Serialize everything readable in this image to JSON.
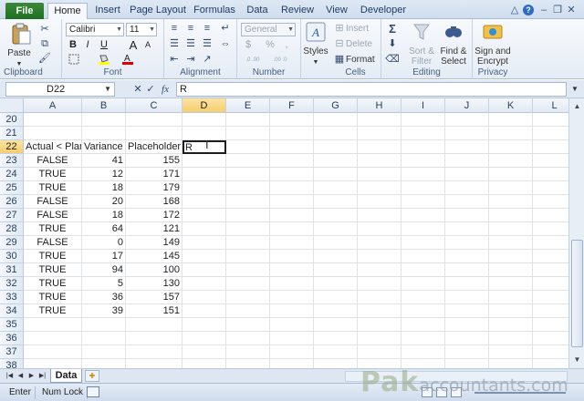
{
  "ribbon_tabs": [
    "File",
    "Home",
    "Insert",
    "Page Layout",
    "Formulas",
    "Data",
    "Review",
    "View",
    "Developer"
  ],
  "window_controls": {
    "minimize": "–",
    "restore": "❐",
    "close": "✕",
    "caret": "△",
    "help": "?"
  },
  "clipboard": {
    "paste_label": "Paste",
    "group_label": "Clipboard"
  },
  "font": {
    "name": "Calibri",
    "size": "11",
    "bold": "B",
    "italic": "I",
    "underline": "U",
    "grow": "A",
    "shrink": "A",
    "fill_color": "#ffff00",
    "font_color": "#e00000",
    "group_label": "Font"
  },
  "alignment": {
    "group_label": "Alignment"
  },
  "number": {
    "format": "General",
    "currency": "$",
    "percent": "%",
    "comma": ",",
    "increase_decimal": ".0 .00",
    "decrease_decimal": ".00 .0",
    "group_label": "Number"
  },
  "styles": {
    "label": "Styles"
  },
  "cells": {
    "insert_label": "Insert",
    "delete_label": "Delete",
    "format_label": "Format",
    "group_label": "Cells"
  },
  "editing": {
    "sigma": "Σ",
    "sort_filter_line1": "Sort &",
    "sort_filter_line2": "Filter",
    "find_select_line1": "Find &",
    "find_select_line2": "Select",
    "group_label": "Editing"
  },
  "privacy": {
    "sign_line1": "Sign and",
    "sign_line2": "Encrypt",
    "group_label": "Privacy"
  },
  "formula_bar": {
    "name_box": "D22",
    "cancel": "✕",
    "enter": "✓",
    "fx": "fx",
    "content": "R"
  },
  "columns": [
    "A",
    "B",
    "C",
    "D",
    "E",
    "F",
    "G",
    "H",
    "I",
    "J",
    "K",
    "L"
  ],
  "selected_column": "D",
  "selected_row": "22",
  "rows": [
    {
      "num": "20",
      "a": "",
      "b": "",
      "c": "",
      "d": ""
    },
    {
      "num": "21",
      "a": "",
      "b": "",
      "c": "",
      "d": ""
    },
    {
      "num": "22",
      "a": "Actual < Plan",
      "b": "Variance",
      "c": "Placeholder",
      "d": "R"
    },
    {
      "num": "23",
      "a": "FALSE",
      "b": "41",
      "c": "155",
      "d": ""
    },
    {
      "num": "24",
      "a": "TRUE",
      "b": "12",
      "c": "171",
      "d": ""
    },
    {
      "num": "25",
      "a": "TRUE",
      "b": "18",
      "c": "179",
      "d": ""
    },
    {
      "num": "26",
      "a": "FALSE",
      "b": "20",
      "c": "168",
      "d": ""
    },
    {
      "num": "27",
      "a": "FALSE",
      "b": "18",
      "c": "172",
      "d": ""
    },
    {
      "num": "28",
      "a": "TRUE",
      "b": "64",
      "c": "121",
      "d": ""
    },
    {
      "num": "29",
      "a": "FALSE",
      "b": "0",
      "c": "149",
      "d": ""
    },
    {
      "num": "30",
      "a": "TRUE",
      "b": "17",
      "c": "145",
      "d": ""
    },
    {
      "num": "31",
      "a": "TRUE",
      "b": "94",
      "c": "100",
      "d": ""
    },
    {
      "num": "32",
      "a": "TRUE",
      "b": "5",
      "c": "130",
      "d": ""
    },
    {
      "num": "33",
      "a": "TRUE",
      "b": "36",
      "c": "157",
      "d": ""
    },
    {
      "num": "34",
      "a": "TRUE",
      "b": "39",
      "c": "151",
      "d": ""
    },
    {
      "num": "35",
      "a": "",
      "b": "",
      "c": "",
      "d": ""
    },
    {
      "num": "36",
      "a": "",
      "b": "",
      "c": "",
      "d": ""
    },
    {
      "num": "37",
      "a": "",
      "b": "",
      "c": "",
      "d": ""
    },
    {
      "num": "38",
      "a": "",
      "b": "",
      "c": "",
      "d": ""
    }
  ],
  "sheet_tab": "Data",
  "status": {
    "mode": "Enter",
    "num_lock": "Num Lock"
  },
  "watermark": {
    "part1": "Pak",
    "part2": "accountants.com"
  }
}
